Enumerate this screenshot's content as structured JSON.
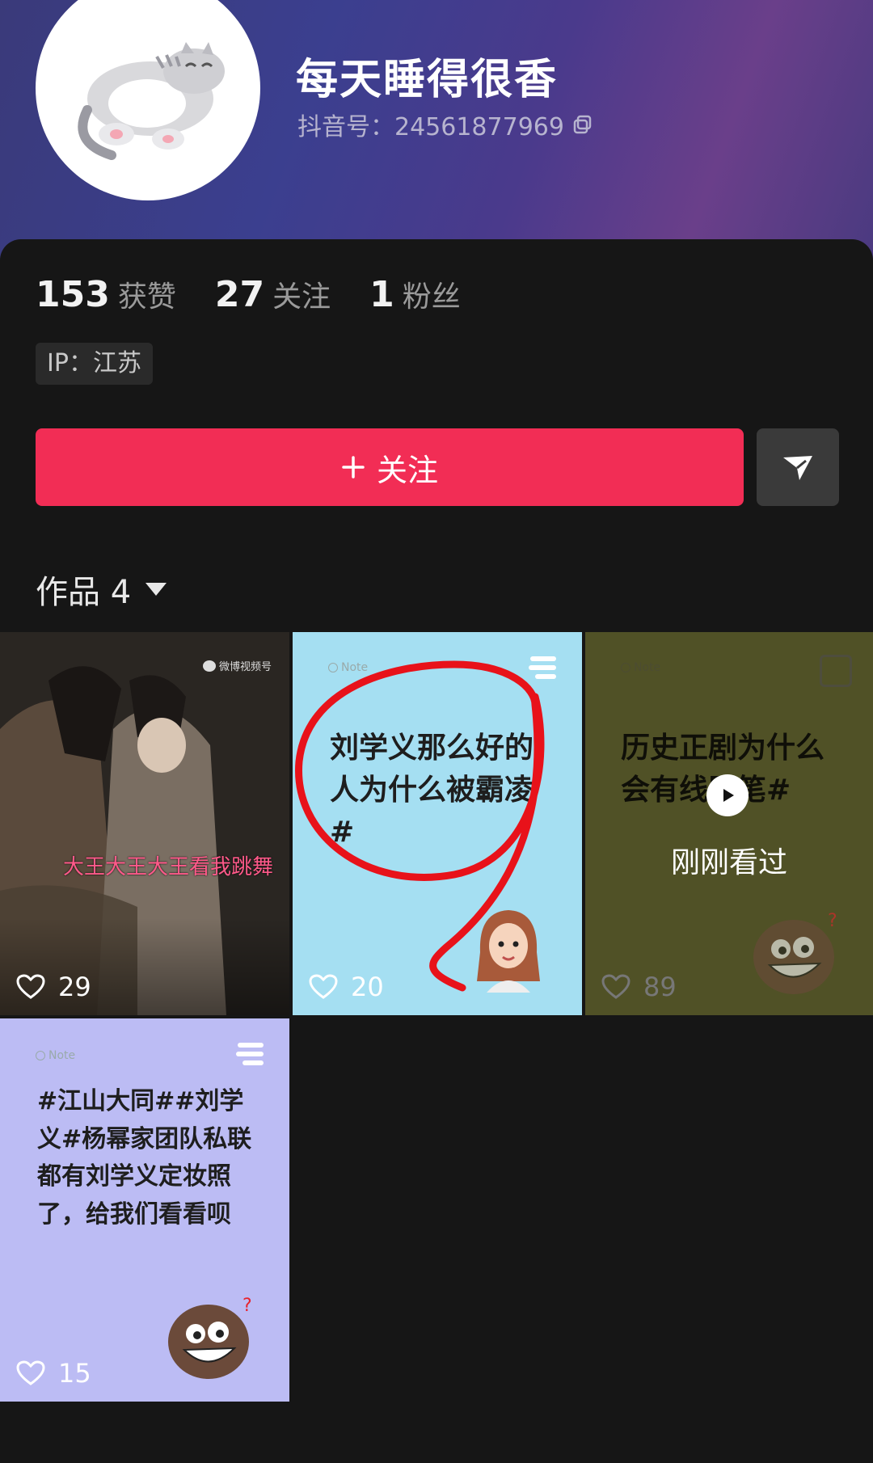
{
  "profile": {
    "name": "每天睡得很香",
    "douyin_id": "抖音号：24561877969",
    "ip": "IP：江苏"
  },
  "stats": [
    {
      "value": "153",
      "label": "获赞"
    },
    {
      "value": "27",
      "label": "关注"
    },
    {
      "value": "1",
      "label": "粉丝"
    }
  ],
  "actions": {
    "follow_label": "关注",
    "follow_icon": "plus-icon",
    "share_icon": "send-icon"
  },
  "works": {
    "label": "作品 4"
  },
  "grid": [
    {
      "type": "video",
      "overlay_text": "大王大王大王看我跳舞",
      "watermark": "微博视频号",
      "likes": "29"
    },
    {
      "type": "note",
      "note_label": "Note",
      "text": "刘学义那么好的人为什么被霸凌#",
      "likes": "20"
    },
    {
      "type": "note",
      "note_label": "Note",
      "text": "历史正剧为什么会有线胶笔#",
      "recent": "刚刚看过",
      "likes": "89"
    },
    {
      "type": "note",
      "note_label": "Note",
      "text": "#江山大同##刘学义#杨幂家团队私联都有刘学义定妆照了，给我们看看呗",
      "likes": "15"
    }
  ],
  "colors": {
    "accent": "#f22d55",
    "background": "#161616"
  }
}
